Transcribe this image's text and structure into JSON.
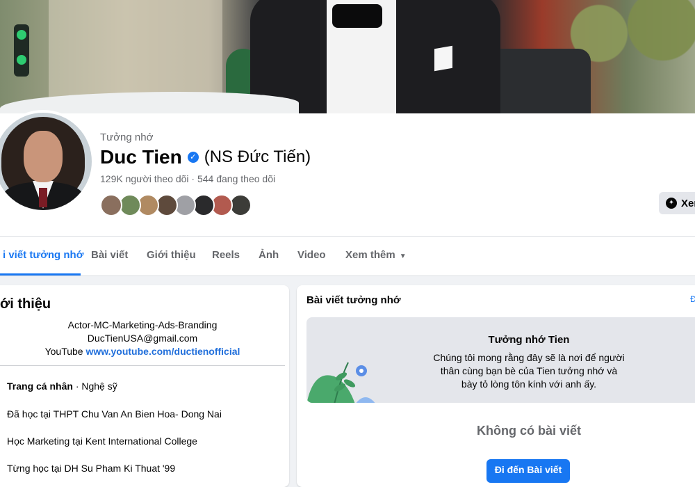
{
  "profile": {
    "memorial_label": "Tưởng nhớ",
    "name": "Duc Tien",
    "verified_mark": "✓",
    "alt_name": "(NS Đức Tiến)",
    "followers": "129K người theo dõi",
    "separator": "·",
    "following": "544 đang theo dõi",
    "message_button": "Xem",
    "friend_avatars": [
      "#8a6f5e",
      "#6f8a5a",
      "#b08a62",
      "#5e4a3c",
      "#9fa0a5",
      "#2a2a2c",
      "#b25a4f",
      "#3c3c38"
    ]
  },
  "tabs": [
    {
      "label": "i viết tưởng nhớ",
      "active": true
    },
    {
      "label": "Bài viết"
    },
    {
      "label": "Giới thiệu"
    },
    {
      "label": "Reels"
    },
    {
      "label": "Ảnh"
    },
    {
      "label": "Video"
    },
    {
      "label": "Xem thêm"
    }
  ],
  "intro": {
    "title": "ới thiệu",
    "bio_line1": "Actor-MC-Marketing-Ads-Branding",
    "bio_line2": "DucTienUSA@gmail.com",
    "bio_line3_prefix": "YouTube",
    "youtube_link": "www.youtube.com/ductienofficial",
    "page_type_label": "Trang cá nhân",
    "page_type_value": "· Nghệ sỹ",
    "item1": "Đã học tại THPT Chu Van An Bien Hoa- Dong Nai",
    "item2": "Học Marketing tại Kent International College",
    "item3": "Từng học tại DH Su Pham Ki Thuat '99"
  },
  "feed": {
    "title": "Bài viết tưởng nhớ",
    "edge_link": "Đ",
    "banner_title": "Tưởng nhớ Tien",
    "banner_text_1": "Chúng tôi mong rằng đây sẽ là nơi để người",
    "banner_text_2": "thân cùng bạn bè của Tien tưởng nhớ và",
    "banner_text_3": "bày tỏ lòng tôn kính với anh ấy.",
    "no_posts": "Không có bài viết",
    "go_button": "Đi đến Bài viết"
  },
  "colors": {
    "accent": "#1877f2",
    "background": "#f0f2f5",
    "muted_text": "#65676b"
  }
}
